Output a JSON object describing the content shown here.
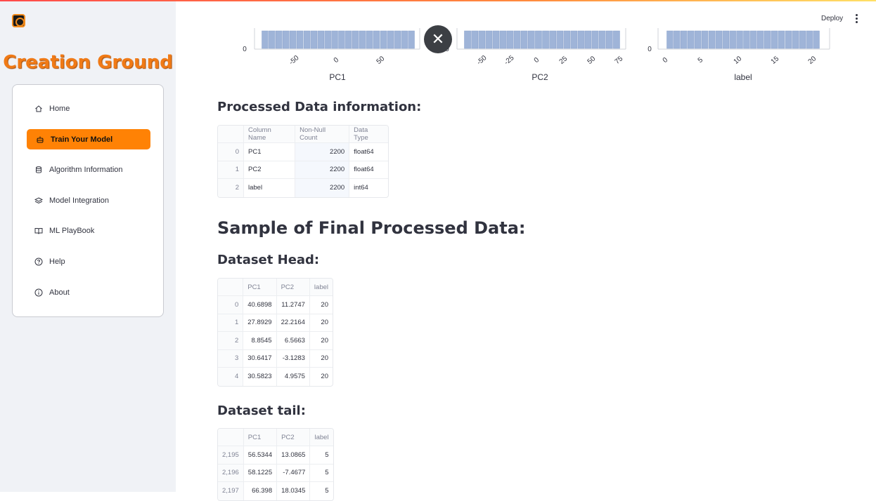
{
  "app": {
    "brand": "Creation Ground"
  },
  "header": {
    "deploy_label": "Deploy"
  },
  "sidebar": {
    "items": [
      {
        "label": "Home",
        "icon": "home-icon"
      },
      {
        "label": "Train Your Model",
        "icon": "robot-icon",
        "active": true
      },
      {
        "label": "Algorithm Information",
        "icon": "database-icon"
      },
      {
        "label": "Model Integration",
        "icon": "layers-icon"
      },
      {
        "label": "ML PlayBook",
        "icon": "book-icon"
      },
      {
        "label": "Help",
        "icon": "help-circle-icon"
      },
      {
        "label": "About",
        "icon": "info-icon"
      }
    ],
    "accent_color": "#ff8205"
  },
  "chart_data": [
    {
      "type": "bar",
      "xlabel": "PC1",
      "x_ticks": [
        "-50",
        "0",
        "50"
      ],
      "y_ticks": [
        "0"
      ]
    },
    {
      "type": "bar",
      "xlabel": "PC2",
      "x_ticks": [
        "0",
        "-50",
        "-25",
        "0",
        "25",
        "50",
        "75"
      ]
    },
    {
      "type": "bar",
      "xlabel": "label",
      "x_ticks": [
        "0",
        "5",
        "10",
        "15",
        "20"
      ],
      "y_ticks": [
        "0"
      ]
    }
  ],
  "processed_info": {
    "title": "Processed Data information:",
    "columns": [
      "Column Name",
      "Non-Null Count",
      "Data Type"
    ],
    "rows": [
      {
        "index": "0",
        "name": "PC1",
        "count": "2200",
        "dtype": "float64"
      },
      {
        "index": "1",
        "name": "PC2",
        "count": "2200",
        "dtype": "float64"
      },
      {
        "index": "2",
        "name": "label",
        "count": "2200",
        "dtype": "int64"
      }
    ]
  },
  "sample": {
    "title": "Sample of Final Processed Data:"
  },
  "head": {
    "title": "Dataset Head:",
    "columns": [
      "PC1",
      "PC2",
      "label"
    ],
    "rows": [
      {
        "index": "0",
        "pc1": "40.6898",
        "pc2": "11.2747",
        "label": "20"
      },
      {
        "index": "1",
        "pc1": "27.8929",
        "pc2": "22.2164",
        "label": "20"
      },
      {
        "index": "2",
        "pc1": "8.8545",
        "pc2": "6.5663",
        "label": "20"
      },
      {
        "index": "3",
        "pc1": "30.6417",
        "pc2": "-3.1283",
        "label": "20"
      },
      {
        "index": "4",
        "pc1": "30.5823",
        "pc2": "4.9575",
        "label": "20"
      }
    ]
  },
  "tail": {
    "title": "Dataset tail:",
    "columns": [
      "PC1",
      "PC2",
      "label"
    ],
    "rows": [
      {
        "index": "2,195",
        "pc1": "56.5344",
        "pc2": "13.0865",
        "label": "5"
      },
      {
        "index": "2,196",
        "pc1": "58.1225",
        "pc2": "-7.4677",
        "label": "5"
      },
      {
        "index": "2,197",
        "pc1": "66.398",
        "pc2": "18.0345",
        "label": "5"
      }
    ]
  }
}
